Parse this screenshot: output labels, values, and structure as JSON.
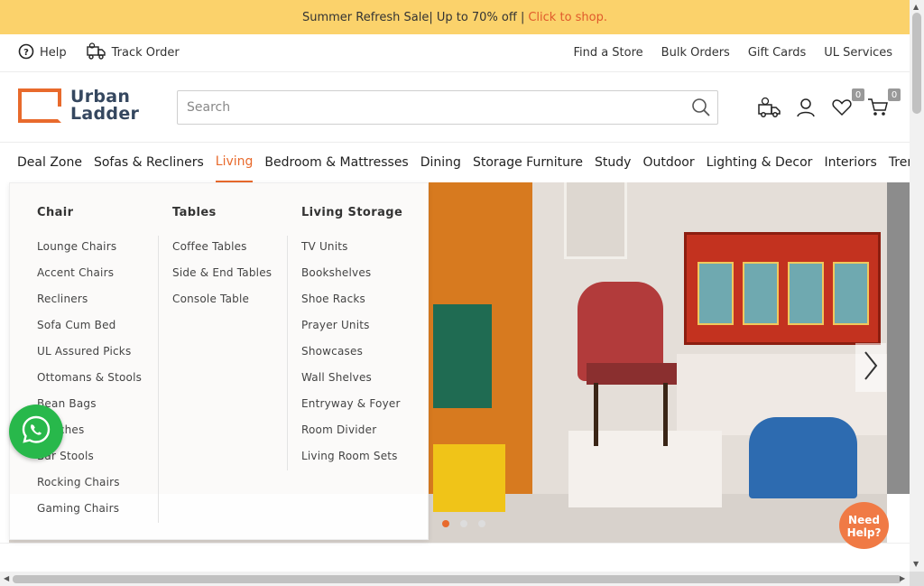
{
  "promo": {
    "text": "Summer Refresh Sale| Up to 70% off |",
    "link": "Click to shop."
  },
  "utility": {
    "help": "Help",
    "track_order": "Track Order",
    "links": [
      "Find a Store",
      "Bulk Orders",
      "Gift Cards",
      "UL Services"
    ]
  },
  "logo": {
    "line1": "Urban",
    "line2": "Ladder"
  },
  "search": {
    "placeholder": "Search",
    "value": ""
  },
  "header_icons": {
    "wishlist_count": "0",
    "cart_count": "0"
  },
  "nav": {
    "items": [
      "Deal Zone",
      "Sofas & Recliners",
      "Living",
      "Bedroom & Mattresses",
      "Dining",
      "Storage Furniture",
      "Study",
      "Outdoor",
      "Lighting & Decor",
      "Interiors",
      "Trending"
    ],
    "active": "Living"
  },
  "dropdown": {
    "columns": [
      {
        "heading": "Chair",
        "items": [
          "Lounge Chairs",
          "Accent Chairs",
          "Recliners",
          "Sofa Cum Bed",
          "UL Assured Picks",
          "Ottomans & Stools",
          "Bean Bags",
          "Benches",
          "Bar Stools",
          "Rocking Chairs",
          "Gaming Chairs"
        ]
      },
      {
        "heading": "Tables",
        "items": [
          "Coffee Tables",
          "Side & End Tables",
          "Console Table"
        ]
      },
      {
        "heading": "Living Storage",
        "items": [
          "TV Units",
          "Bookshelves",
          "Shoe Racks",
          "Prayer Units",
          "Showcases",
          "Wall Shelves",
          "Entryway & Foyer",
          "Room Divider",
          "Living Room Sets"
        ]
      }
    ]
  },
  "need_help": {
    "line1": "Need",
    "line2": "Help?"
  },
  "colors": {
    "accent": "#e86a2c",
    "promo_bg": "#fbd26b",
    "whatsapp": "#28b84b"
  }
}
